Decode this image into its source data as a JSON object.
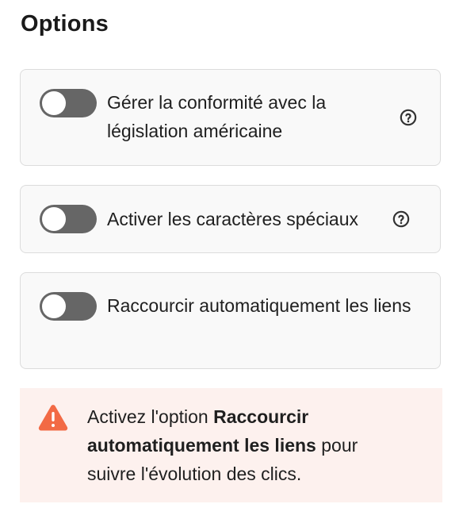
{
  "title": "Options",
  "options": [
    {
      "label": "Gérer la conformité avec la législation américaine",
      "enabled": false,
      "help_icon": "question-circle-icon"
    },
    {
      "label": "Activer les caractères spéciaux",
      "enabled": false,
      "help_icon": "question-circle-icon"
    },
    {
      "label": "Raccourcir automatiquement les liens",
      "enabled": false
    }
  ],
  "alert": {
    "icon": "warning-triangle-icon",
    "icon_color": "#f26a45",
    "background": "#fdf1ee",
    "text_before": "Activez l'option ",
    "text_bold": "Raccourcir automatiquement les liens",
    "text_after": " pour suivre l'évolution des clics."
  },
  "colors": {
    "toggle_off": "#666666",
    "card_background": "#f9f9f9",
    "card_border": "#dcdcdc"
  }
}
